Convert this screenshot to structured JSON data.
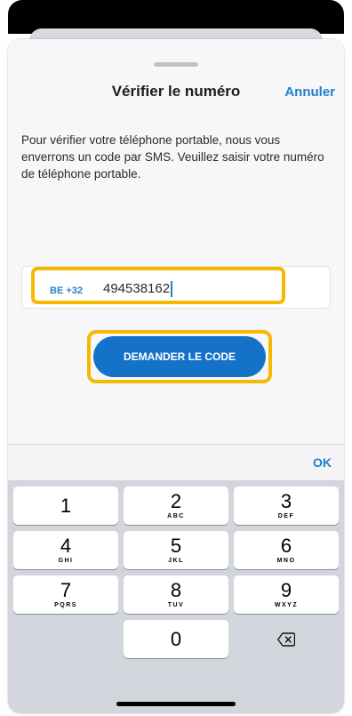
{
  "header": {
    "title": "Vérifier le numéro",
    "cancel_label": "Annuler"
  },
  "description": "Pour vérifier votre téléphone portable, nous vous enverrons un code par SMS. Veuillez saisir votre numéro de téléphone portable.",
  "phone_input": {
    "country_prefix": "BE +32",
    "value": "494538162"
  },
  "request_button_label": "DEMANDER LE CODE",
  "keyboard": {
    "ok_label": "OK",
    "keys": [
      {
        "digit": "1",
        "letters": ""
      },
      {
        "digit": "2",
        "letters": "ABC"
      },
      {
        "digit": "3",
        "letters": "DEF"
      },
      {
        "digit": "4",
        "letters": "GHI"
      },
      {
        "digit": "5",
        "letters": "JKL"
      },
      {
        "digit": "6",
        "letters": "MNO"
      },
      {
        "digit": "7",
        "letters": "PQRS"
      },
      {
        "digit": "8",
        "letters": "TUV"
      },
      {
        "digit": "9",
        "letters": "WXYZ"
      },
      {
        "digit": "0",
        "letters": ""
      }
    ],
    "delete_icon": "backspace-icon"
  },
  "colors": {
    "accent": "#1f7fc6",
    "button": "#1473c9",
    "highlight": "#f6b900",
    "keyboard_bg": "#d2d5db"
  }
}
